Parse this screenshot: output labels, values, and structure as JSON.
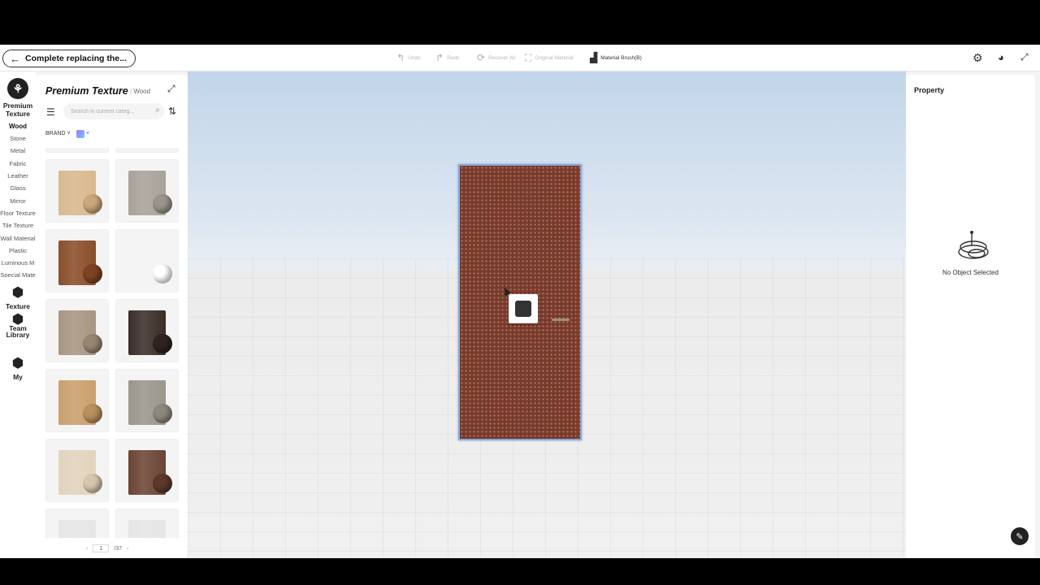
{
  "toolbar": {
    "back_label": "Complete replacing the...",
    "tools": [
      {
        "label": "Undo",
        "icon": "undo-icon"
      },
      {
        "label": "Redo",
        "icon": "redo-icon"
      },
      {
        "label": "Recover All",
        "icon": "recover-icon"
      },
      {
        "label": "Original Material",
        "icon": "original-material-icon"
      },
      {
        "label": "Material Brush(B)",
        "icon": "brush-icon"
      }
    ]
  },
  "nav": {
    "main": [
      {
        "label": "Premium Texture"
      },
      {
        "label": "Texture"
      },
      {
        "label": "Team Library"
      },
      {
        "label": "My"
      }
    ],
    "categories": [
      "Wood",
      "Stone",
      "Metal",
      "Fabric",
      "Leather",
      "Glass",
      "Mirror",
      "Floor Texture",
      "Tile Texture",
      "Wall Material",
      "Plastic",
      "Luminous M",
      "Special Mate"
    ]
  },
  "panel": {
    "title": "Premium Texture",
    "subtitle": "Wood",
    "search_placeholder": "Search in current categ...",
    "brand_label": "BRAND",
    "page_current": "1",
    "page_total": "/37"
  },
  "textures": [
    {
      "slab": "#5a3b30",
      "ball": "#5a3b30"
    },
    {
      "slab": "#4a2e25",
      "ball": "#4a2e25"
    },
    {
      "slab": "#d9b98f",
      "ball": "#caa77c"
    },
    {
      "slab": "#a8a29a",
      "ball": "#9a948c"
    },
    {
      "slab": "#8a4e2a",
      "ball": "#7a4424"
    },
    {
      "slab": "#f4f4f4",
      "ball": "#ffffff"
    },
    {
      "slab": "#a89682",
      "ball": "#978670"
    },
    {
      "slab": "#3a2d28",
      "ball": "#2e231f"
    },
    {
      "slab": "#c9a06d",
      "ball": "#b88f5e"
    },
    {
      "slab": "#9b968c",
      "ball": "#8d887e"
    },
    {
      "slab": "#e2d3bd",
      "ball": "#d6c6ae"
    },
    {
      "slab": "#6b4434",
      "ball": "#5c392b"
    },
    {
      "slab": "#e6e6e6",
      "ball": "#d0d0d0"
    },
    {
      "slab": "#e6e6e6",
      "ball": "#d0d0d0"
    }
  ],
  "property": {
    "title": "Property",
    "empty_text": "No Object Selected"
  },
  "colors": {
    "door": "#7a3a2a",
    "selection_outline": "#8aa7d6"
  }
}
